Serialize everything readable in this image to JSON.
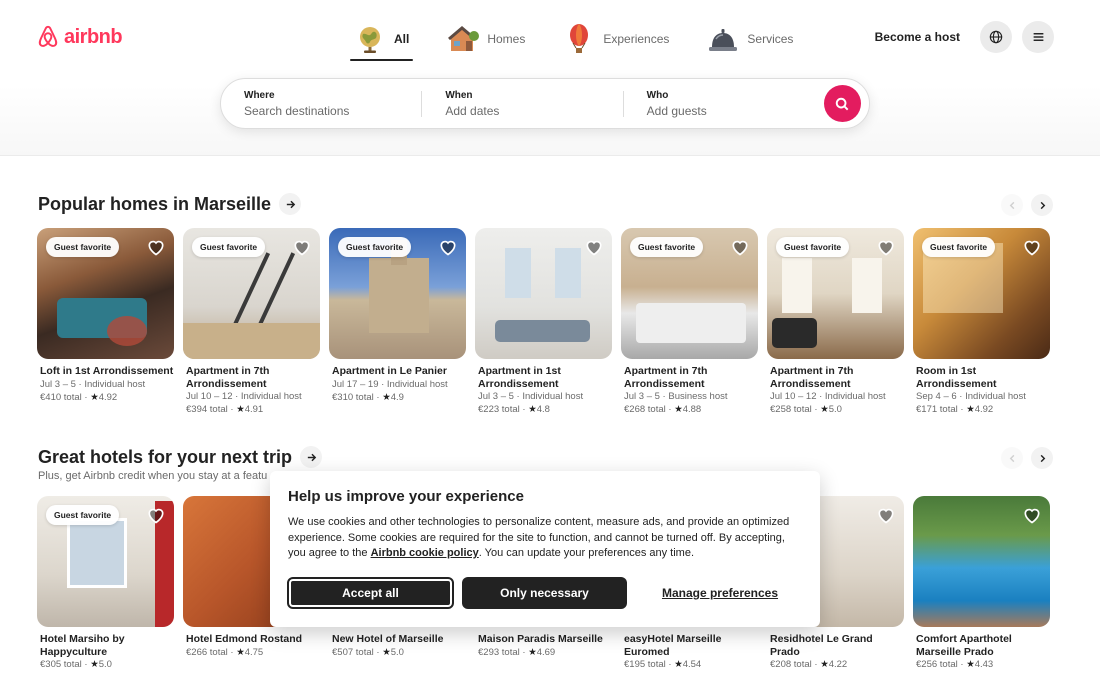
{
  "header": {
    "logo_text": "airbnb",
    "brand_color": "#ff385c",
    "tabs": [
      {
        "label": "All",
        "icon": "globe-icon",
        "active": true
      },
      {
        "label": "Homes",
        "icon": "house-icon",
        "active": false
      },
      {
        "label": "Experiences",
        "icon": "hot-air-balloon-icon",
        "active": false
      },
      {
        "label": "Services",
        "icon": "service-bell-icon",
        "active": false
      }
    ],
    "become_host": "Become a host"
  },
  "search": {
    "where_label": "Where",
    "where_placeholder": "Search destinations",
    "when_label": "When",
    "when_placeholder": "Add dates",
    "who_label": "Who",
    "who_placeholder": "Add guests",
    "button_color": "#e31c5f"
  },
  "popular": {
    "title": "Popular homes in Marseille",
    "listings": [
      {
        "badge": "Guest favorite",
        "title": "Loft in 1st Arrondissement",
        "meta": "Jul 3 – 5 · Individual host",
        "price": "€410 total",
        "rating": "4.92"
      },
      {
        "badge": "Guest favorite",
        "title": "Apartment in 7th Arrondissement",
        "meta": "Jul 10 – 12 · Individual host",
        "price": "€394 total",
        "rating": "4.91"
      },
      {
        "badge": "Guest favorite",
        "title": "Apartment in Le Panier",
        "meta": "Jul 17 – 19 · Individual host",
        "price": "€310 total",
        "rating": "4.9"
      },
      {
        "badge": "",
        "title": "Apartment in 1st Arrondissement",
        "meta": "Jul 3 – 5 · Individual host",
        "price": "€223 total",
        "rating": "4.8"
      },
      {
        "badge": "Guest favorite",
        "title": "Apartment in 7th Arrondissement",
        "meta": "Jul 3 – 5 · Business host",
        "price": "€268 total",
        "rating": "4.88"
      },
      {
        "badge": "Guest favorite",
        "title": "Apartment in 7th Arrondissement",
        "meta": "Jul 10 – 12 · Individual host",
        "price": "€258 total",
        "rating": "5.0"
      },
      {
        "badge": "Guest favorite",
        "title": "Room in 1st Arrondissement",
        "meta": "Sep 4 – 6 · Individual host",
        "price": "€171 total",
        "rating": "4.92"
      }
    ]
  },
  "hotels": {
    "title": "Great hotels for your next trip",
    "subtitle": "Plus, get Airbnb credit when you stay at a featu",
    "listings": [
      {
        "badge": "Guest favorite",
        "title": "Hotel Marsiho by Happyculture",
        "price": "€305 total",
        "rating": "5.0"
      },
      {
        "badge": "",
        "title": "Hotel Edmond Rostand",
        "price": "€266 total",
        "rating": "4.75"
      },
      {
        "badge": "",
        "title": "New Hotel of Marseille",
        "price": "€507 total",
        "rating": "5.0"
      },
      {
        "badge": "",
        "title": "Maison Paradis Marseille",
        "price": "€293 total",
        "rating": "4.69"
      },
      {
        "badge": "",
        "title": "easyHotel Marseille Euromed",
        "price": "€195 total",
        "rating": "4.54"
      },
      {
        "badge": "",
        "title": "Residhotel Le Grand Prado",
        "price": "€208 total",
        "rating": "4.22"
      },
      {
        "badge": "",
        "title": "Comfort Aparthotel Marseille Prado",
        "price": "€256 total",
        "rating": "4.43"
      }
    ]
  },
  "cookie": {
    "title": "Help us improve your experience",
    "body_before": "We use cookies and other technologies to personalize content, measure ads, and provide an optimized experience. Some cookies are required for the site to function, and cannot be turned off. By accepting, you agree to the ",
    "link": "Airbnb cookie policy",
    "body_after": ". You can update your preferences any time.",
    "accept_all": "Accept all",
    "only_necessary": "Only necessary",
    "manage": "Manage preferences"
  }
}
